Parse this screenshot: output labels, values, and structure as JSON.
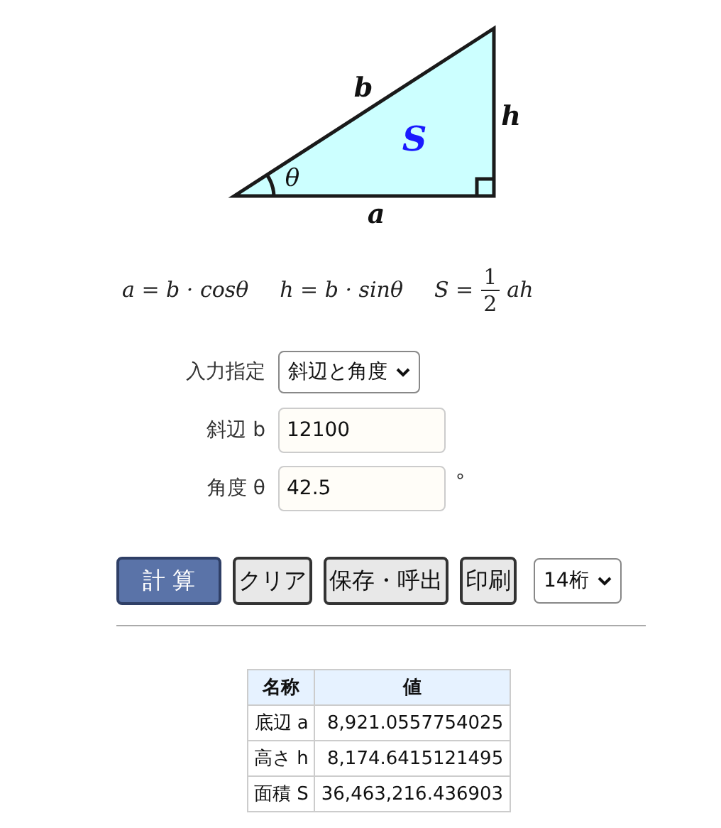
{
  "diagram": {
    "labels": [
      {
        "kind": "side",
        "text": "b"
      },
      {
        "kind": "side",
        "text": "h"
      },
      {
        "kind": "area",
        "text": "S"
      },
      {
        "kind": "angle",
        "text": "θ"
      },
      {
        "kind": "side",
        "text": "a"
      }
    ]
  },
  "formulas": [
    {
      "kind": "plain",
      "text": "a = b · cosθ"
    },
    {
      "kind": "plain",
      "text": "h = b · sinθ"
    },
    {
      "kind": "fraction",
      "lhs": "S =",
      "numerator": "1",
      "denominator": "2",
      "rhs": "ah"
    }
  ],
  "form": {
    "fields": [
      {
        "kind": "select",
        "label": "入力指定",
        "value": "斜辺と角度"
      },
      {
        "kind": "input",
        "label": "斜辺 b",
        "value": "12100"
      },
      {
        "kind": "input",
        "label": "角度 θ",
        "value": "42.5",
        "unit": "°"
      }
    ]
  },
  "buttons": [
    {
      "kind": "primary",
      "label": "計 算"
    },
    {
      "kind": "normal",
      "label": "クリア"
    },
    {
      "kind": "normal",
      "label": "保存・呼出"
    },
    {
      "kind": "normal",
      "label": "印刷"
    },
    {
      "kind": "select",
      "label": "14桁"
    }
  ],
  "table": {
    "columns": [
      "名称",
      "値"
    ],
    "rows": [
      [
        "底辺 a",
        "8,921.0557754025"
      ],
      [
        "高さ h",
        "8,174.6415121495"
      ],
      [
        "面積 S",
        "36,463,216.436903"
      ]
    ]
  }
}
